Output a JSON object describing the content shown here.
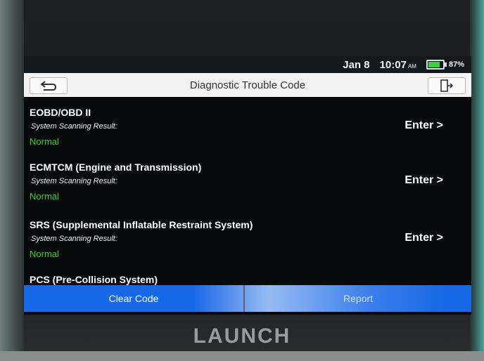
{
  "status_bar": {
    "date": "Jan 8",
    "time": "10:07",
    "ampm": "AM",
    "battery_percent": "87%",
    "battery_level": 0.87
  },
  "title_bar": {
    "title": "Diagnostic Trouble Code",
    "back_icon": "back-arrow-icon",
    "exit_icon": "exit-door-icon"
  },
  "systems": [
    {
      "name": "EOBD/OBD II",
      "result_label": "System Scanning Result:",
      "result": "Normal",
      "action": "Enter >"
    },
    {
      "name": "ECMTCM (Engine and Transmission)",
      "result_label": "System Scanning Result:",
      "result": "Normal",
      "action": "Enter >"
    },
    {
      "name": "SRS (Supplemental Inflatable Restraint System)",
      "result_label": "System Scanning Result:",
      "result": "Normal",
      "action": "Enter >"
    },
    {
      "name": "PCS (Pre-Collision System)"
    }
  ],
  "bottom_buttons": {
    "clear": "Clear Code",
    "report": "Report"
  },
  "brand": "LAUNCH",
  "colors": {
    "accent_blue": "#1768e6",
    "status_green": "#3bd23b",
    "screen_bg": "#07090a"
  }
}
